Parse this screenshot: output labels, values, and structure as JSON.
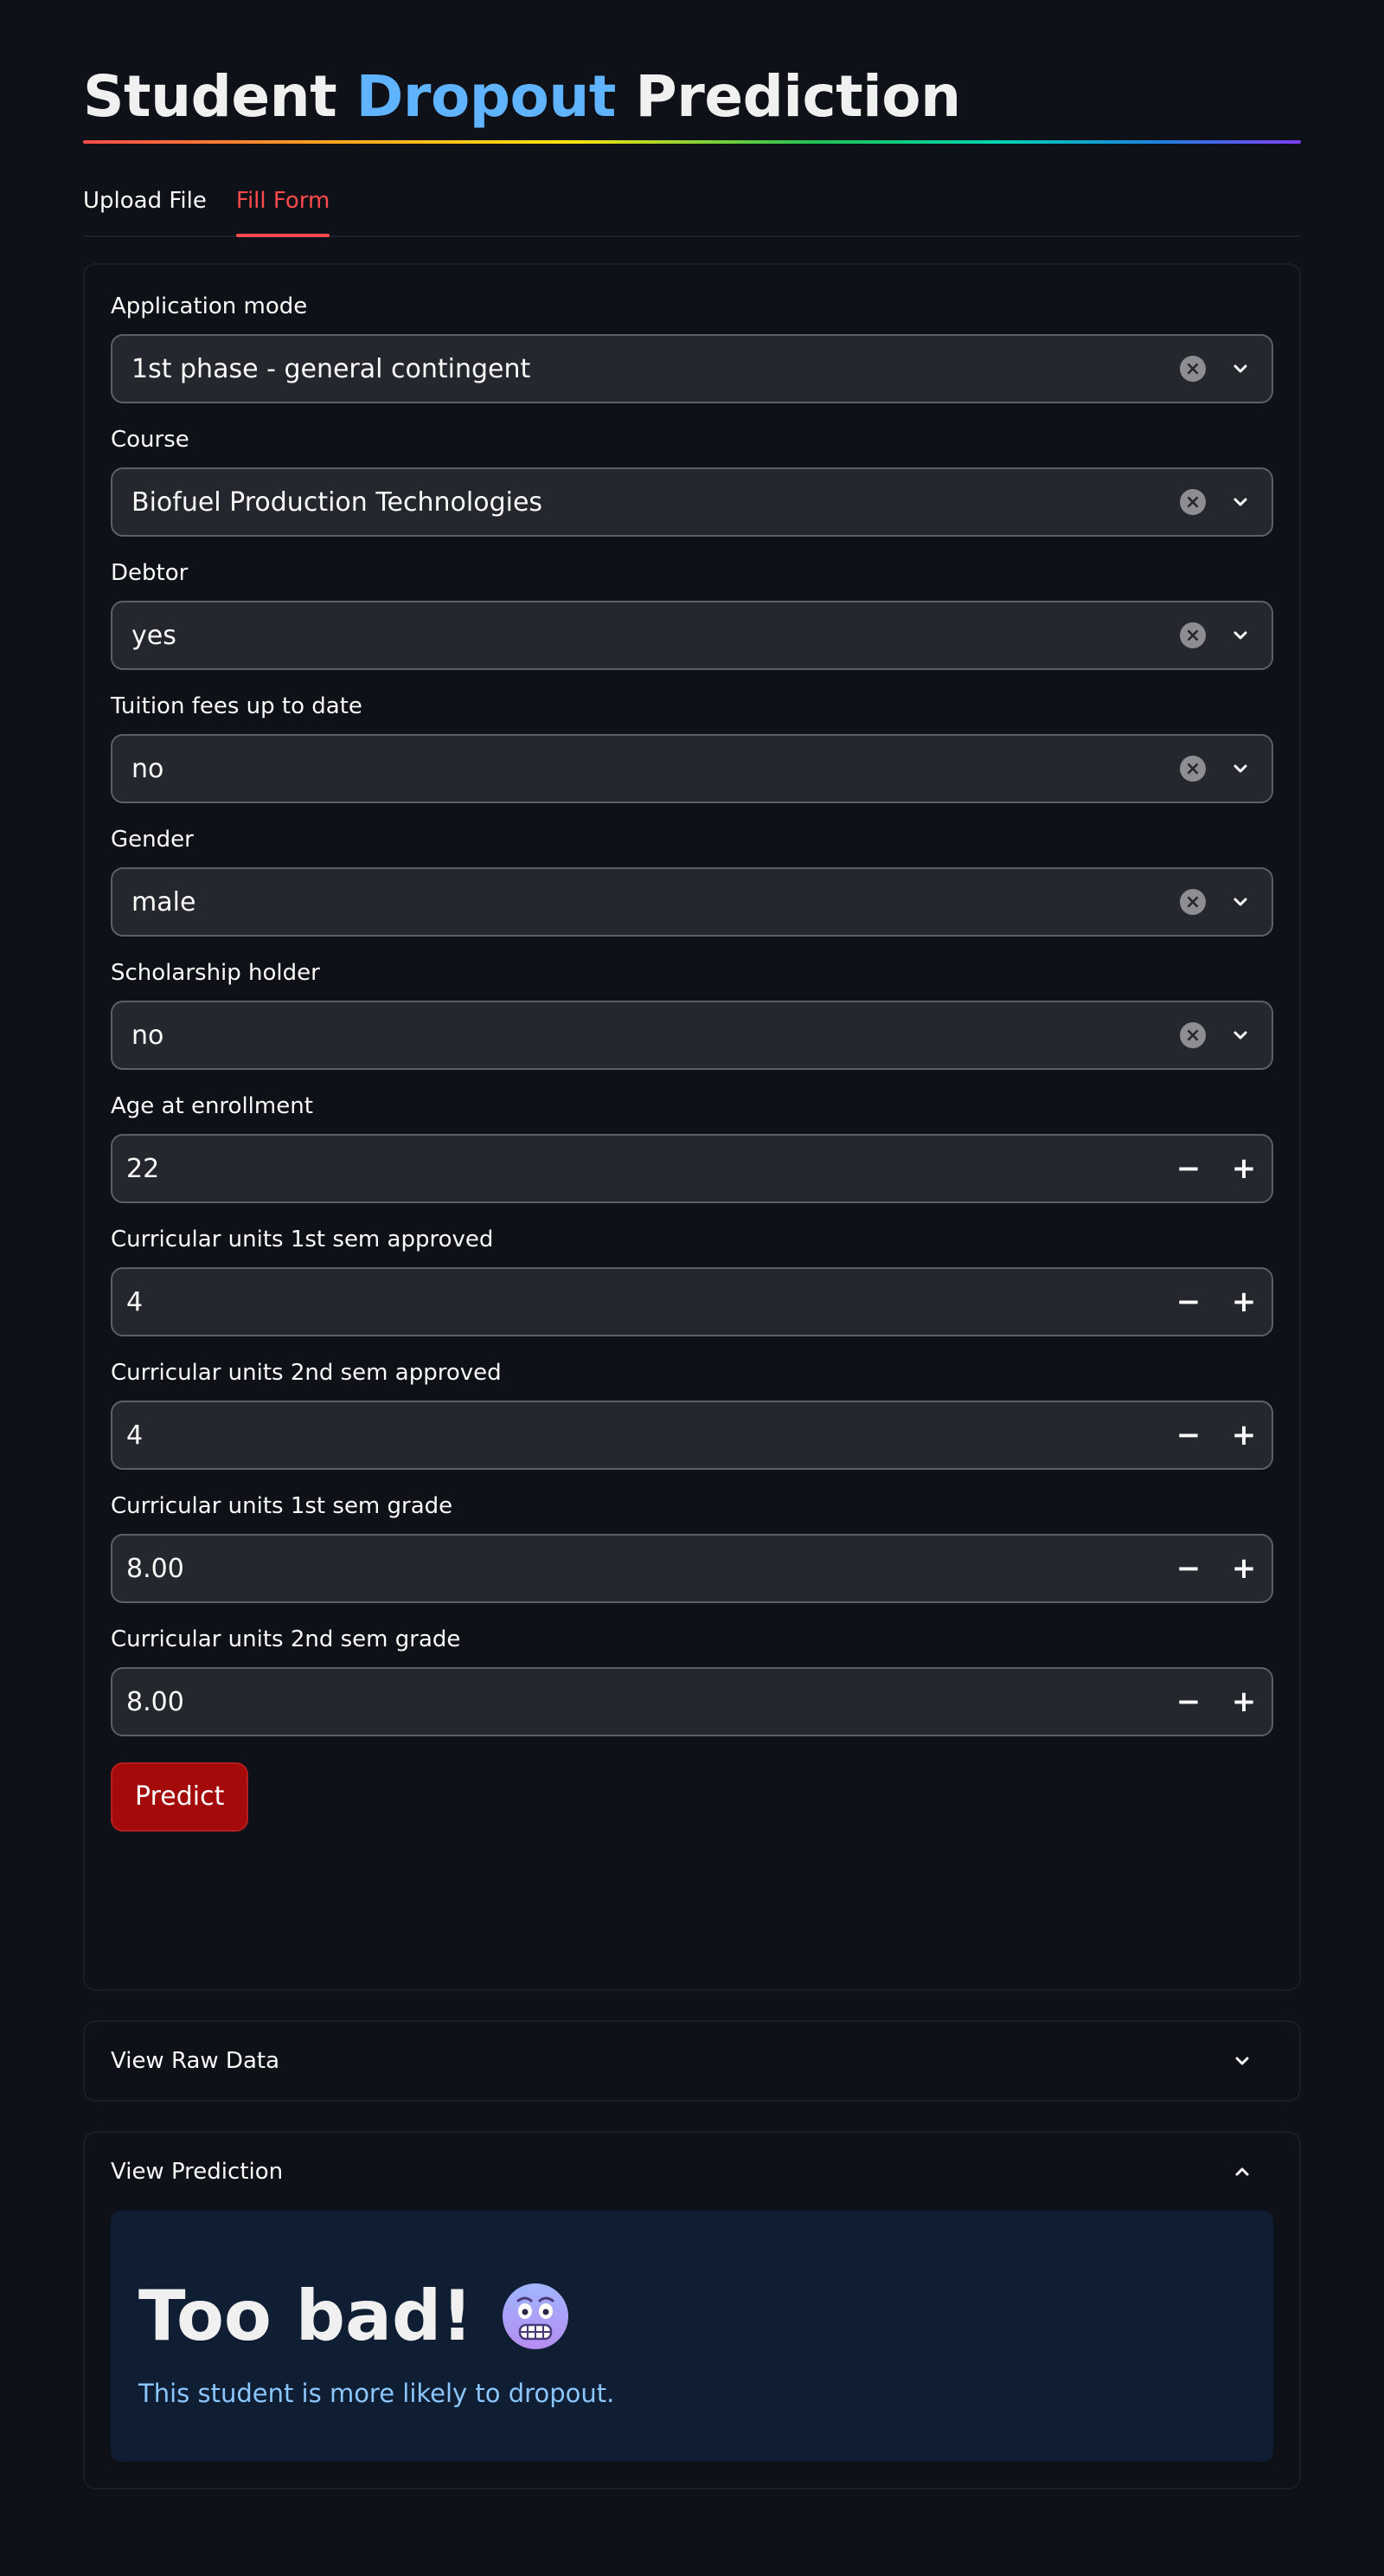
{
  "header": {
    "title_part1": "Student",
    "title_accent": "Dropout",
    "title_part2": "Prediction"
  },
  "tabs": [
    {
      "label": "Upload File",
      "active": false
    },
    {
      "label": "Fill Form",
      "active": true
    }
  ],
  "form": {
    "selects": [
      {
        "label": "Application mode",
        "value": "1st phase - general contingent"
      },
      {
        "label": "Course",
        "value": "Biofuel Production Technologies"
      },
      {
        "label": "Debtor",
        "value": "yes"
      },
      {
        "label": "Tuition fees up to date",
        "value": "no"
      },
      {
        "label": "Gender",
        "value": "male"
      },
      {
        "label": "Scholarship holder",
        "value": "no"
      }
    ],
    "numbers": [
      {
        "label": "Age at enrollment",
        "value": "22"
      },
      {
        "label": "Curricular units 1st sem approved",
        "value": "4"
      },
      {
        "label": "Curricular units 2nd sem approved",
        "value": "4"
      },
      {
        "label": "Curricular units 1st sem grade",
        "value": "8.00"
      },
      {
        "label": "Curricular units 2nd sem grade",
        "value": "8.00"
      }
    ],
    "predict_label": "Predict"
  },
  "expanders": {
    "raw_data": {
      "title": "View Raw Data",
      "expanded": false
    },
    "prediction": {
      "title": "View Prediction",
      "expanded": true
    }
  },
  "result": {
    "heading": "Too bad!",
    "emoji": "cold-face-emoji",
    "message": "This student is more likely to dropout."
  },
  "colors": {
    "background": "#0e1117",
    "accent_red": "#ff4b4b",
    "title_accent": "#60b4ff",
    "predict_button": "#a50a0a",
    "result_bg": "#0f1e33",
    "result_text": "#8cc6ff"
  }
}
